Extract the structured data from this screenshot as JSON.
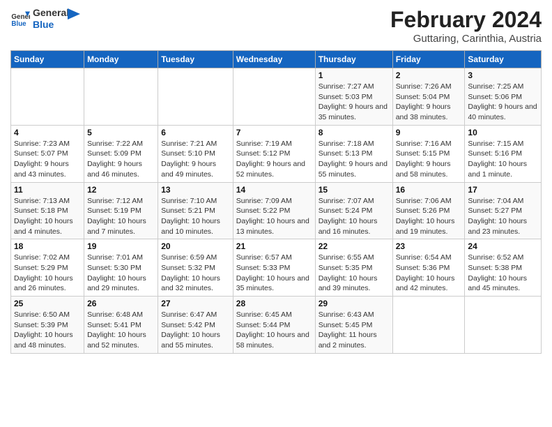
{
  "logo": {
    "line1": "General",
    "line2": "Blue"
  },
  "title": "February 2024",
  "subtitle": "Guttaring, Carinthia, Austria",
  "days_of_week": [
    "Sunday",
    "Monday",
    "Tuesday",
    "Wednesday",
    "Thursday",
    "Friday",
    "Saturday"
  ],
  "weeks": [
    [
      {
        "day": "",
        "sunrise": "",
        "sunset": "",
        "daylight": ""
      },
      {
        "day": "",
        "sunrise": "",
        "sunset": "",
        "daylight": ""
      },
      {
        "day": "",
        "sunrise": "",
        "sunset": "",
        "daylight": ""
      },
      {
        "day": "",
        "sunrise": "",
        "sunset": "",
        "daylight": ""
      },
      {
        "day": "1",
        "sunrise": "Sunrise: 7:27 AM",
        "sunset": "Sunset: 5:03 PM",
        "daylight": "Daylight: 9 hours and 35 minutes."
      },
      {
        "day": "2",
        "sunrise": "Sunrise: 7:26 AM",
        "sunset": "Sunset: 5:04 PM",
        "daylight": "Daylight: 9 hours and 38 minutes."
      },
      {
        "day": "3",
        "sunrise": "Sunrise: 7:25 AM",
        "sunset": "Sunset: 5:06 PM",
        "daylight": "Daylight: 9 hours and 40 minutes."
      }
    ],
    [
      {
        "day": "4",
        "sunrise": "Sunrise: 7:23 AM",
        "sunset": "Sunset: 5:07 PM",
        "daylight": "Daylight: 9 hours and 43 minutes."
      },
      {
        "day": "5",
        "sunrise": "Sunrise: 7:22 AM",
        "sunset": "Sunset: 5:09 PM",
        "daylight": "Daylight: 9 hours and 46 minutes."
      },
      {
        "day": "6",
        "sunrise": "Sunrise: 7:21 AM",
        "sunset": "Sunset: 5:10 PM",
        "daylight": "Daylight: 9 hours and 49 minutes."
      },
      {
        "day": "7",
        "sunrise": "Sunrise: 7:19 AM",
        "sunset": "Sunset: 5:12 PM",
        "daylight": "Daylight: 9 hours and 52 minutes."
      },
      {
        "day": "8",
        "sunrise": "Sunrise: 7:18 AM",
        "sunset": "Sunset: 5:13 PM",
        "daylight": "Daylight: 9 hours and 55 minutes."
      },
      {
        "day": "9",
        "sunrise": "Sunrise: 7:16 AM",
        "sunset": "Sunset: 5:15 PM",
        "daylight": "Daylight: 9 hours and 58 minutes."
      },
      {
        "day": "10",
        "sunrise": "Sunrise: 7:15 AM",
        "sunset": "Sunset: 5:16 PM",
        "daylight": "Daylight: 10 hours and 1 minute."
      }
    ],
    [
      {
        "day": "11",
        "sunrise": "Sunrise: 7:13 AM",
        "sunset": "Sunset: 5:18 PM",
        "daylight": "Daylight: 10 hours and 4 minutes."
      },
      {
        "day": "12",
        "sunrise": "Sunrise: 7:12 AM",
        "sunset": "Sunset: 5:19 PM",
        "daylight": "Daylight: 10 hours and 7 minutes."
      },
      {
        "day": "13",
        "sunrise": "Sunrise: 7:10 AM",
        "sunset": "Sunset: 5:21 PM",
        "daylight": "Daylight: 10 hours and 10 minutes."
      },
      {
        "day": "14",
        "sunrise": "Sunrise: 7:09 AM",
        "sunset": "Sunset: 5:22 PM",
        "daylight": "Daylight: 10 hours and 13 minutes."
      },
      {
        "day": "15",
        "sunrise": "Sunrise: 7:07 AM",
        "sunset": "Sunset: 5:24 PM",
        "daylight": "Daylight: 10 hours and 16 minutes."
      },
      {
        "day": "16",
        "sunrise": "Sunrise: 7:06 AM",
        "sunset": "Sunset: 5:26 PM",
        "daylight": "Daylight: 10 hours and 19 minutes."
      },
      {
        "day": "17",
        "sunrise": "Sunrise: 7:04 AM",
        "sunset": "Sunset: 5:27 PM",
        "daylight": "Daylight: 10 hours and 23 minutes."
      }
    ],
    [
      {
        "day": "18",
        "sunrise": "Sunrise: 7:02 AM",
        "sunset": "Sunset: 5:29 PM",
        "daylight": "Daylight: 10 hours and 26 minutes."
      },
      {
        "day": "19",
        "sunrise": "Sunrise: 7:01 AM",
        "sunset": "Sunset: 5:30 PM",
        "daylight": "Daylight: 10 hours and 29 minutes."
      },
      {
        "day": "20",
        "sunrise": "Sunrise: 6:59 AM",
        "sunset": "Sunset: 5:32 PM",
        "daylight": "Daylight: 10 hours and 32 minutes."
      },
      {
        "day": "21",
        "sunrise": "Sunrise: 6:57 AM",
        "sunset": "Sunset: 5:33 PM",
        "daylight": "Daylight: 10 hours and 35 minutes."
      },
      {
        "day": "22",
        "sunrise": "Sunrise: 6:55 AM",
        "sunset": "Sunset: 5:35 PM",
        "daylight": "Daylight: 10 hours and 39 minutes."
      },
      {
        "day": "23",
        "sunrise": "Sunrise: 6:54 AM",
        "sunset": "Sunset: 5:36 PM",
        "daylight": "Daylight: 10 hours and 42 minutes."
      },
      {
        "day": "24",
        "sunrise": "Sunrise: 6:52 AM",
        "sunset": "Sunset: 5:38 PM",
        "daylight": "Daylight: 10 hours and 45 minutes."
      }
    ],
    [
      {
        "day": "25",
        "sunrise": "Sunrise: 6:50 AM",
        "sunset": "Sunset: 5:39 PM",
        "daylight": "Daylight: 10 hours and 48 minutes."
      },
      {
        "day": "26",
        "sunrise": "Sunrise: 6:48 AM",
        "sunset": "Sunset: 5:41 PM",
        "daylight": "Daylight: 10 hours and 52 minutes."
      },
      {
        "day": "27",
        "sunrise": "Sunrise: 6:47 AM",
        "sunset": "Sunset: 5:42 PM",
        "daylight": "Daylight: 10 hours and 55 minutes."
      },
      {
        "day": "28",
        "sunrise": "Sunrise: 6:45 AM",
        "sunset": "Sunset: 5:44 PM",
        "daylight": "Daylight: 10 hours and 58 minutes."
      },
      {
        "day": "29",
        "sunrise": "Sunrise: 6:43 AM",
        "sunset": "Sunset: 5:45 PM",
        "daylight": "Daylight: 11 hours and 2 minutes."
      },
      {
        "day": "",
        "sunrise": "",
        "sunset": "",
        "daylight": ""
      },
      {
        "day": "",
        "sunrise": "",
        "sunset": "",
        "daylight": ""
      }
    ]
  ]
}
